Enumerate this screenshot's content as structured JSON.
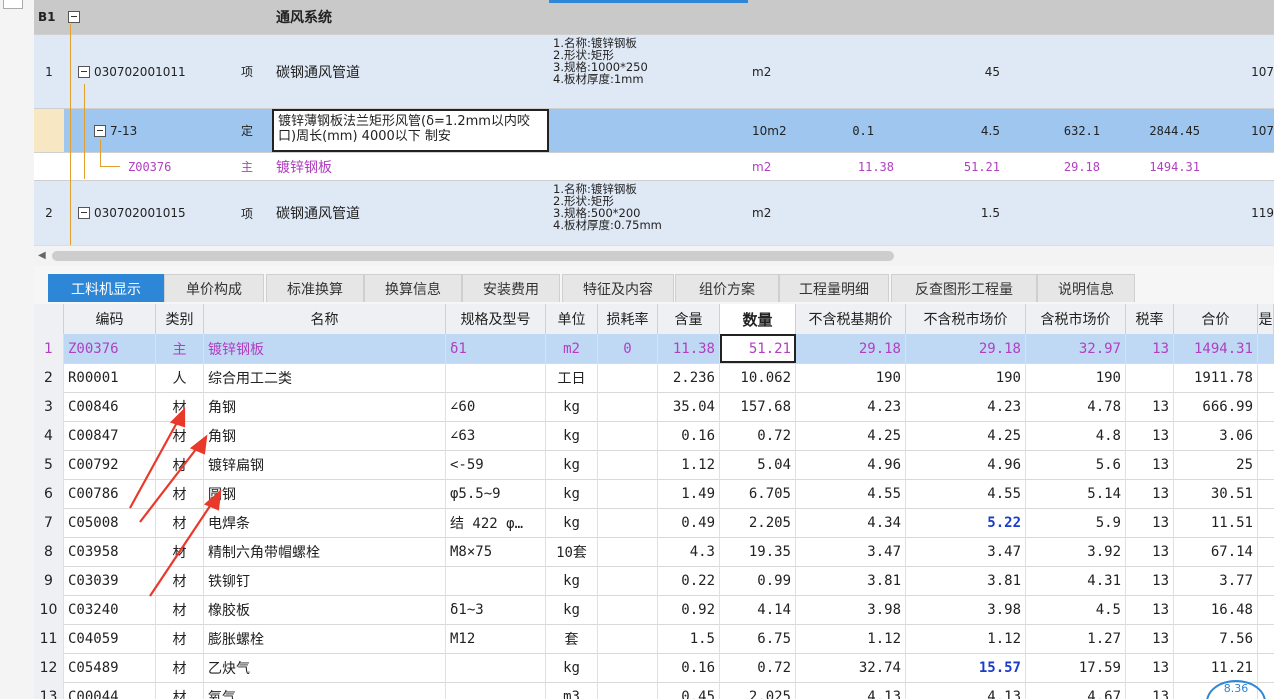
{
  "upper": {
    "section": {
      "id": "B1",
      "name": "通风系统"
    },
    "rows": [
      {
        "num": "1",
        "code": "030702001011",
        "type": "项",
        "name": "碳钢通风管道",
        "spec": [
          "1.名称:镀锌钢板",
          "2.形状:矩形",
          "3.规格:1000*250",
          "4.板材厚度:1mm"
        ],
        "unit": "m2",
        "qty_ratio": "",
        "qty": "45",
        "price": "",
        "total": "",
        "extra": "107"
      },
      {
        "num": "",
        "code": "7-13",
        "type": "定",
        "name": "镀锌薄钢板法兰矩形风管(δ=1.2mm以内咬口)周长(mm) 4000以下 制安",
        "spec": [],
        "unit": "10m2",
        "qty_ratio": "0.1",
        "qty": "4.5",
        "price": "632.1",
        "total": "2844.45",
        "extra": "107"
      },
      {
        "num": "",
        "code": "Z00376",
        "type": "主",
        "name": "镀锌钢板",
        "spec": [],
        "unit": "m2",
        "qty_ratio": "11.38",
        "qty": "51.21",
        "price": "29.18",
        "total": "1494.31",
        "extra": ""
      },
      {
        "num": "2",
        "code": "030702001015",
        "type": "项",
        "name": "碳钢通风管道",
        "spec": [
          "1.名称:镀锌钢板",
          "2.形状:矩形",
          "3.规格:500*200",
          "4.板材厚度:0.75mm"
        ],
        "unit": "m2",
        "qty_ratio": "",
        "qty": "1.5",
        "price": "",
        "total": "",
        "extra": "119"
      }
    ]
  },
  "tabs": [
    "工料机显示",
    "单价构成",
    "标准换算",
    "换算信息",
    "安装费用",
    "特征及内容",
    "组价方案",
    "工程量明细",
    "反查图形工程量",
    "说明信息"
  ],
  "lower": {
    "headers": [
      "编码",
      "类别",
      "名称",
      "规格及型号",
      "单位",
      "损耗率",
      "含量",
      "数量",
      "不含税基期价",
      "不含税市场价",
      "含税市场价",
      "税率",
      "合价",
      "是"
    ],
    "rows": [
      [
        "1",
        "Z00376",
        "主",
        "镀锌钢板",
        "δ1",
        "m2",
        "0",
        "11.38",
        "51.21",
        "29.18",
        "29.18",
        "32.97",
        "13",
        "1494.31"
      ],
      [
        "2",
        "R00001",
        "人",
        "综合用工二类",
        "",
        "工日",
        "",
        "2.236",
        "10.062",
        "190",
        "190",
        "190",
        "",
        "1911.78"
      ],
      [
        "3",
        "C00846",
        "材",
        "角钢",
        "∠60",
        "kg",
        "",
        "35.04",
        "157.68",
        "4.23",
        "4.23",
        "4.78",
        "13",
        "666.99"
      ],
      [
        "4",
        "C00847",
        "材",
        "角钢",
        "∠63",
        "kg",
        "",
        "0.16",
        "0.72",
        "4.25",
        "4.25",
        "4.8",
        "13",
        "3.06"
      ],
      [
        "5",
        "C00792",
        "材",
        "镀锌扁钢",
        "<-59",
        "kg",
        "",
        "1.12",
        "5.04",
        "4.96",
        "4.96",
        "5.6",
        "13",
        "25"
      ],
      [
        "6",
        "C00786",
        "材",
        "圆钢",
        "φ5.5~9",
        "kg",
        "",
        "1.49",
        "6.705",
        "4.55",
        "4.55",
        "5.14",
        "13",
        "30.51"
      ],
      [
        "7",
        "C05008",
        "材",
        "电焊条",
        "结 422 φ…",
        "kg",
        "",
        "0.49",
        "2.205",
        "4.34",
        "5.22",
        "5.9",
        "13",
        "11.51"
      ],
      [
        "8",
        "C03958",
        "材",
        "精制六角带帽螺栓",
        "M8×75",
        "10套",
        "",
        "4.3",
        "19.35",
        "3.47",
        "3.47",
        "3.92",
        "13",
        "67.14"
      ],
      [
        "9",
        "C03039",
        "材",
        "铁铆钉",
        "",
        "kg",
        "",
        "0.22",
        "0.99",
        "3.81",
        "3.81",
        "4.31",
        "13",
        "3.77"
      ],
      [
        "10",
        "C03240",
        "材",
        "橡胶板",
        "δ1~3",
        "kg",
        "",
        "0.92",
        "4.14",
        "3.98",
        "3.98",
        "4.5",
        "13",
        "16.48"
      ],
      [
        "11",
        "C04059",
        "材",
        "膨胀螺栓",
        "M12",
        "套",
        "",
        "1.5",
        "6.75",
        "1.12",
        "1.12",
        "1.27",
        "13",
        "7.56"
      ],
      [
        "12",
        "C05489",
        "材",
        "乙炔气",
        "",
        "kg",
        "",
        "0.16",
        "0.72",
        "32.74",
        "15.57",
        "17.59",
        "13",
        "11.21"
      ],
      [
        "13",
        "C00044",
        "材",
        "氧气",
        "",
        "m3",
        "",
        "0.45",
        "2.025",
        "4.13",
        "4.13",
        "4.67",
        "13",
        ""
      ]
    ],
    "badge": "8.36"
  },
  "colors": {
    "accent": "#2d86d6",
    "highlight_row": "#bfd9f5",
    "purple_text": "#b040c0",
    "bold_blue": "#1a3cc8",
    "arrow": "#e8392a"
  }
}
